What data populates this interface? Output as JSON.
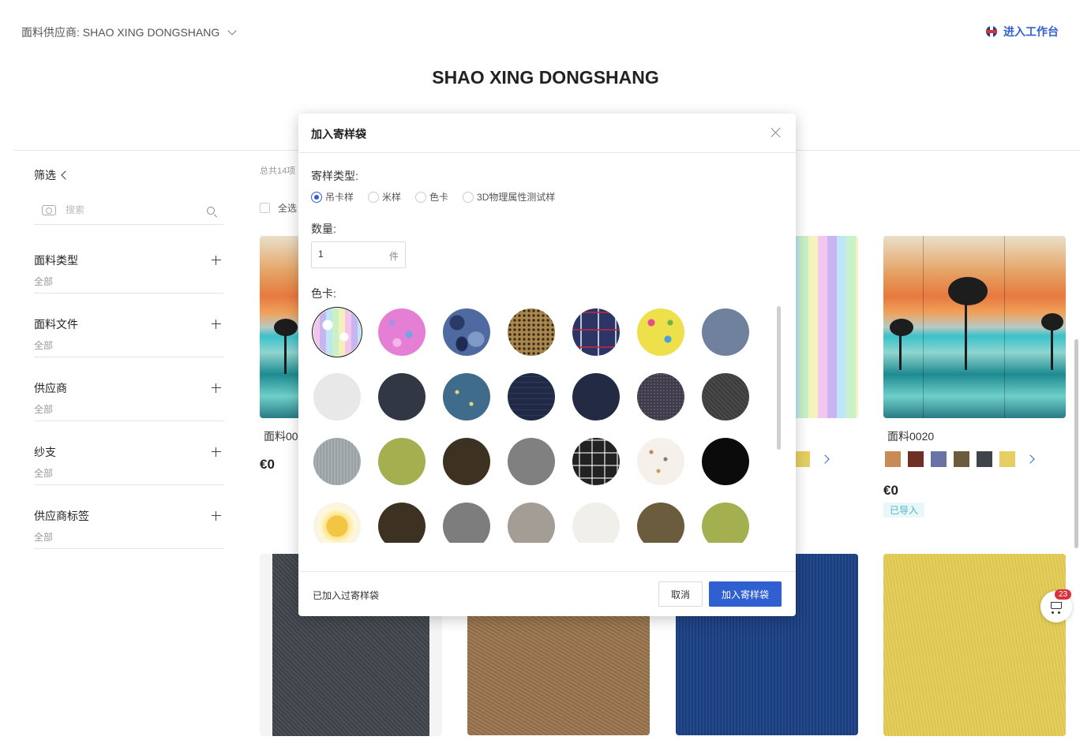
{
  "header": {
    "supplier_label": "面料供应商: SHAO XING DONGSHANG",
    "workbench_label": "进入工作台",
    "page_title": "SHAO XING DONGSHANG"
  },
  "sidebar": {
    "filter_title": "筛选",
    "search_placeholder": "搜索",
    "groups": [
      {
        "label": "面料类型",
        "value": "全部"
      },
      {
        "label": "面料文件",
        "value": "全部"
      },
      {
        "label": "供应商",
        "value": "全部"
      },
      {
        "label": "纱支",
        "value": "全部"
      },
      {
        "label": "供应商标签",
        "value": "全部"
      }
    ]
  },
  "products": {
    "total": "总共14项",
    "select_all": "全选",
    "cards": [
      {
        "name": "面料00",
        "price": "€0"
      },
      {
        "name": "面料0020",
        "price": "€0",
        "tag": "已导入"
      }
    ]
  },
  "colors": {
    "accent": "#2f5fd0",
    "card4_swatches": [
      "#c98a55",
      "#6e2f25",
      "#6a74a4",
      "#6a5c3c",
      "#3f434a",
      "#e5cf62"
    ]
  },
  "cart": {
    "count": "23"
  },
  "modal": {
    "title": "加入寄样袋",
    "sample_type_label": "寄样类型:",
    "sample_types": [
      "吊卡样",
      "米样",
      "色卡",
      "3D物理属性测试样"
    ],
    "selected_type_index": 0,
    "quantity_label": "数量:",
    "quantity_value": "1",
    "quantity_unit": "件",
    "color_card_label": "色卡:",
    "swatches": [
      "rainbow-print",
      "pink-paisley",
      "blue-camo",
      "leopard",
      "navy-plaid",
      "yellow-doodle",
      "#6f819d",
      "#e8e8e8",
      "#323744",
      "teal-print",
      "navy-check",
      "#232a44",
      "dark-heather",
      "charcoal",
      "grey-stripe",
      "#a4b04f",
      "#3d3221",
      "#808080",
      "bw-plaid",
      "sprinkle",
      "#0b0b0b",
      "sun-print",
      "#3d3221",
      "#7d7d7d",
      "#a39d96",
      "#f0efea",
      "#6b5c3d",
      "#a4b04f"
    ],
    "selected_swatch_index": 0,
    "footer_note": "已加入过寄样袋",
    "cancel_label": "取消",
    "confirm_label": "加入寄样袋"
  }
}
